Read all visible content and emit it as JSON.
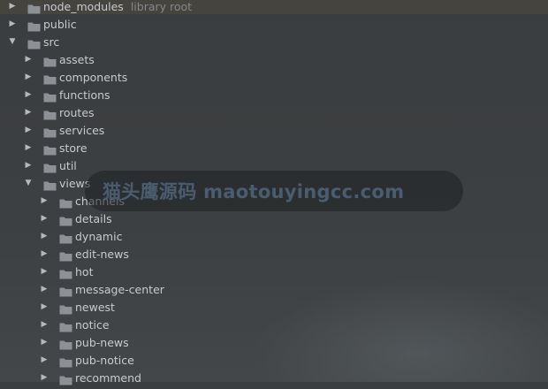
{
  "tree": {
    "root_hint": "library root",
    "items": [
      {
        "label": "node_modules",
        "expanded": false
      },
      {
        "label": "public",
        "expanded": false
      },
      {
        "label": "src",
        "expanded": true
      },
      {
        "label": "assets",
        "expanded": false
      },
      {
        "label": "components",
        "expanded": false
      },
      {
        "label": "functions",
        "expanded": false
      },
      {
        "label": "routes",
        "expanded": false
      },
      {
        "label": "services",
        "expanded": false
      },
      {
        "label": "store",
        "expanded": false
      },
      {
        "label": "util",
        "expanded": false
      },
      {
        "label": "views",
        "expanded": true
      },
      {
        "label": "channels",
        "expanded": false
      },
      {
        "label": "details",
        "expanded": false
      },
      {
        "label": "dynamic",
        "expanded": false
      },
      {
        "label": "edit-news",
        "expanded": false
      },
      {
        "label": "hot",
        "expanded": false
      },
      {
        "label": "message-center",
        "expanded": false
      },
      {
        "label": "newest",
        "expanded": false
      },
      {
        "label": "notice",
        "expanded": false
      },
      {
        "label": "pub-news",
        "expanded": false
      },
      {
        "label": "pub-notice",
        "expanded": false
      },
      {
        "label": "recommend",
        "expanded": false
      }
    ]
  },
  "watermark": {
    "text": "猫头鹰源码 maotouyingcc.com"
  },
  "colors": {
    "background": "#3b3e40",
    "text": "#c8cbce",
    "folder": "#8d9196",
    "watermark_text": "#4b5c70"
  }
}
